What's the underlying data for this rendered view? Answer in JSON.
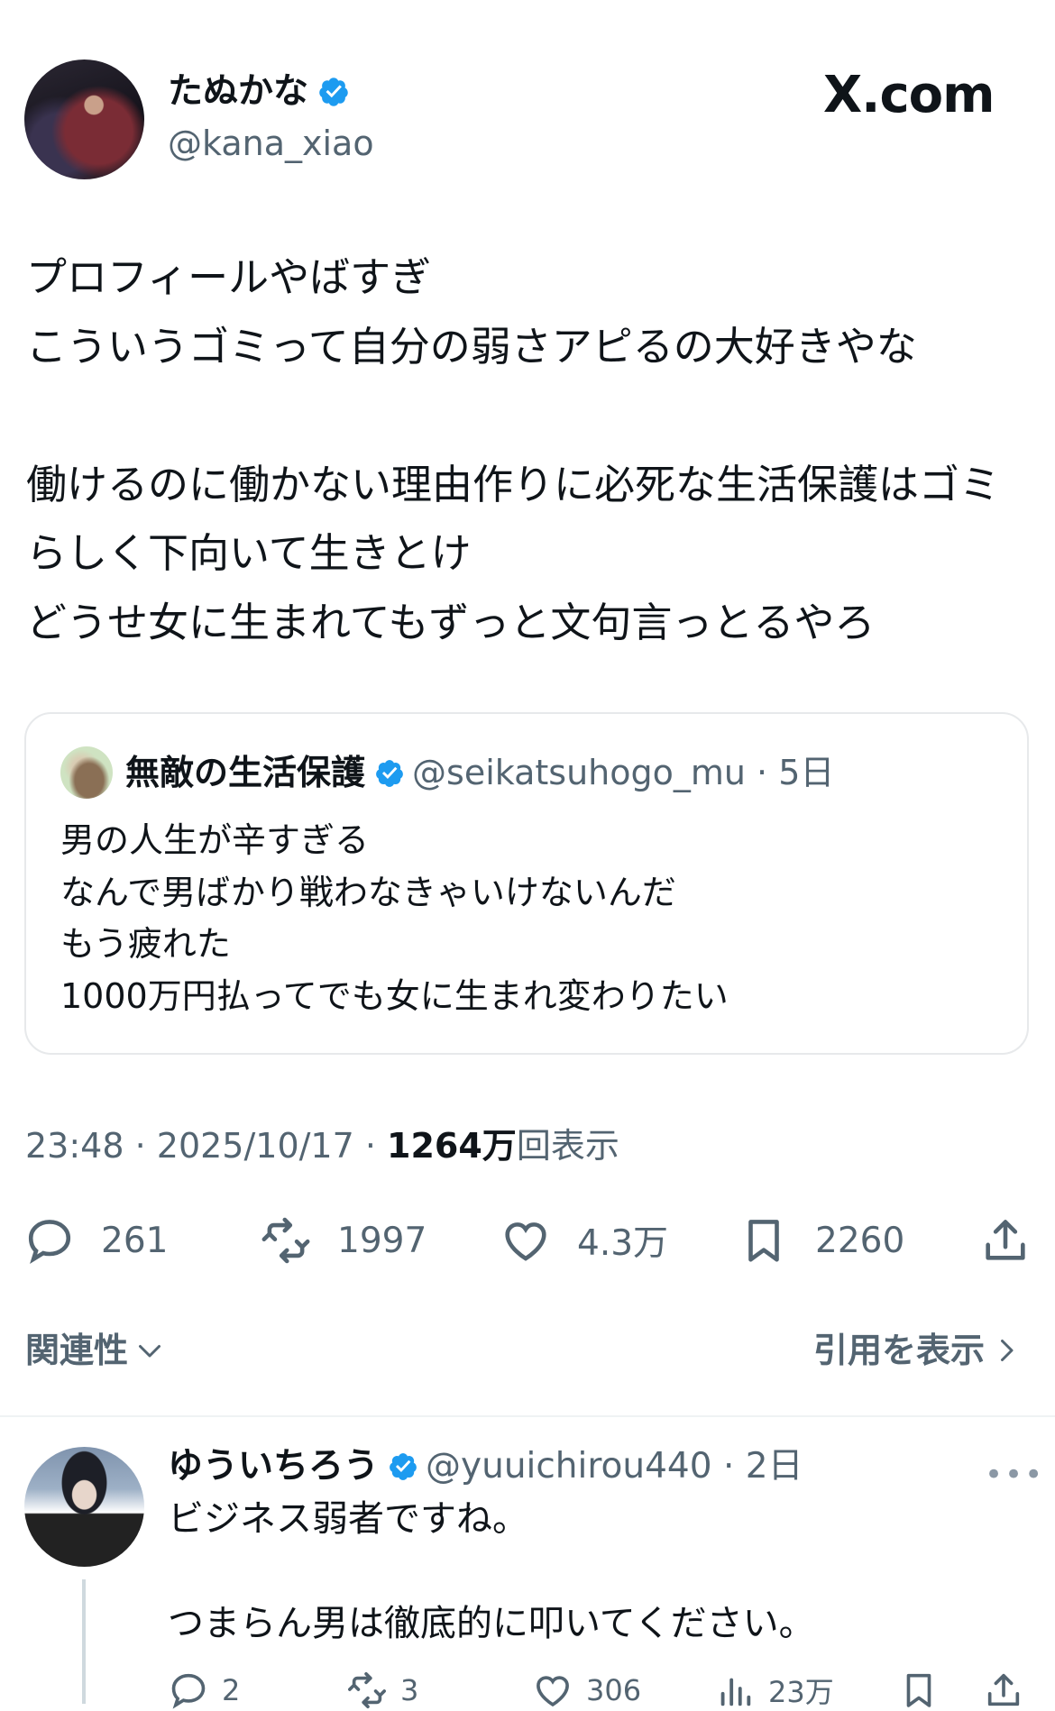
{
  "site": {
    "brand": "X.com"
  },
  "tweet": {
    "author_name": "たぬかな",
    "author_handle": "@kana_xiao",
    "verified": true,
    "text": "プロフィールやばすぎ\nこういうゴミって自分の弱さアピるの大好きやな\n\n働けるのに働かない理由作りに必死な生活保護はゴミらしく下向いて生きとけ\nどうせ女に生まれてもずっと文句言っとるやろ",
    "time": "23:48",
    "date": "2025/10/17",
    "views_count": "1264万",
    "views_label": "回表示",
    "stats": {
      "replies": "261",
      "reposts": "1997",
      "likes": "4.3万",
      "bookmarks": "2260"
    }
  },
  "quoted_tweet": {
    "author_name": "無敵の生活保護",
    "author_handle": "@seikatsuhogo_mu",
    "age": "5日",
    "text": "男の人生が辛すぎる\nなんで男ばかり戦わなきゃいけないんだ\nもう疲れた\n1000万円払ってでも女に生まれ変わりたい"
  },
  "sort_bar": {
    "sort_label": "関連性",
    "quotes_link": "引用を表示"
  },
  "reply": {
    "author_name": "ゆういちろう",
    "author_handle": "@yuuichirou440",
    "age": "2日",
    "text": "ビジネス弱者ですね。\n\nつまらん男は徹底的に叩いてください。",
    "stats": {
      "replies": "2",
      "reposts": "3",
      "likes": "306",
      "views": "23万"
    }
  },
  "colors": {
    "verified_blue": "#1d9bf0",
    "secondary_text": "#536471",
    "primary_text": "#0f1419"
  },
  "icons": [
    "verified-badge-icon",
    "reply-icon",
    "repost-icon",
    "like-icon",
    "bookmark-icon",
    "share-icon",
    "chevron-down-icon",
    "chevron-right-icon",
    "more-icon",
    "views-icon"
  ]
}
